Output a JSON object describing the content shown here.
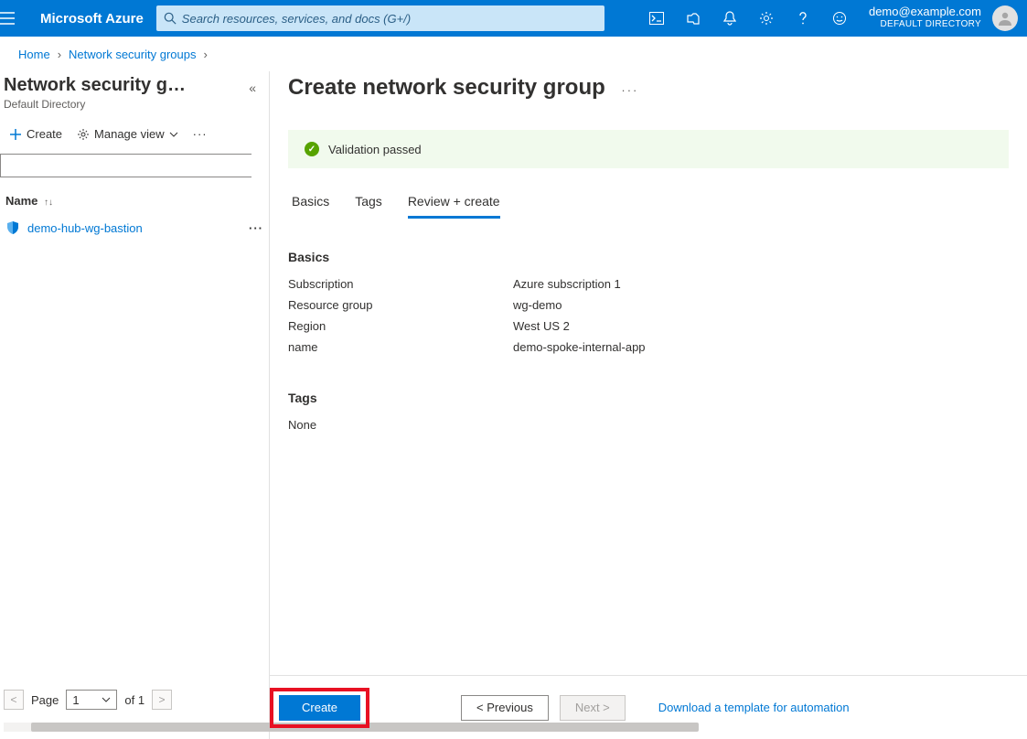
{
  "header": {
    "brand": "Microsoft Azure",
    "search_placeholder": "Search resources, services, and docs (G+/)",
    "account_email": "demo@example.com",
    "account_directory": "DEFAULT DIRECTORY"
  },
  "breadcrumb": {
    "home": "Home",
    "nsg": "Network security groups"
  },
  "sidebar": {
    "title": "Network security g…",
    "subtitle": "Default Directory",
    "create_label": "Create",
    "manage_view_label": "Manage view",
    "column_name": "Name",
    "item_name": "demo-hub-wg-bastion",
    "pager_label": "Page",
    "pager_current": "1",
    "pager_of": "of 1"
  },
  "main": {
    "title": "Create network security group",
    "validation_msg": "Validation passed",
    "tabs": {
      "basics": "Basics",
      "tags": "Tags",
      "review": "Review + create"
    },
    "sections": {
      "basics_title": "Basics",
      "subscription_label": "Subscription",
      "subscription_value": "Azure subscription 1",
      "rg_label": "Resource group",
      "rg_value": "wg-demo",
      "region_label": "Region",
      "region_value": "West US 2",
      "name_label": "name",
      "name_value": "demo-spoke-internal-app",
      "tags_title": "Tags",
      "tags_none": "None"
    },
    "footer": {
      "create": "Create",
      "previous": "< Previous",
      "next": "Next >",
      "download": "Download a template for automation"
    }
  }
}
